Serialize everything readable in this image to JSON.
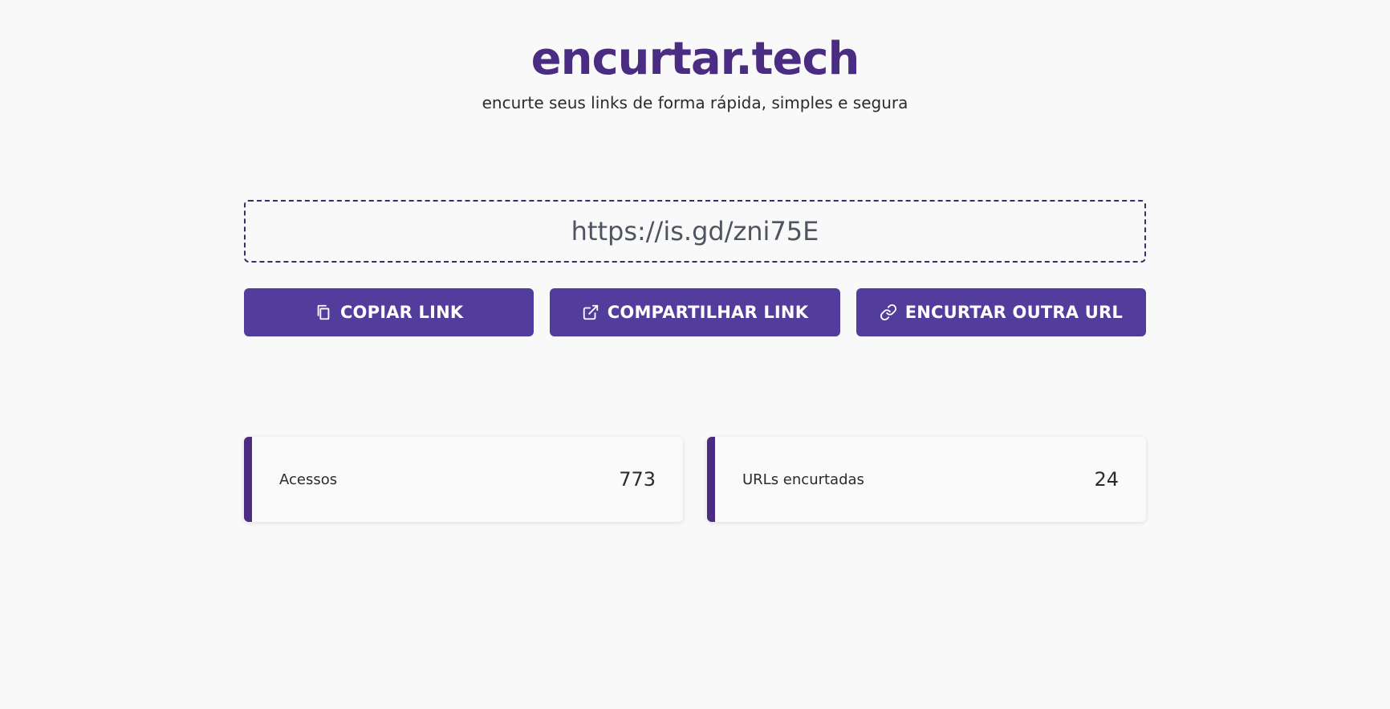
{
  "header": {
    "logo": "encurtar.tech",
    "tagline": "encurte seus links de forma rápida, simples e segura"
  },
  "result": {
    "short_url": "https://is.gd/zni75E"
  },
  "actions": {
    "copy_label": "COPIAR LINK",
    "share_label": "COMPARTILHAR LINK",
    "new_label": "ENCURTAR OUTRA URL"
  },
  "icons": {
    "copy": "copy-icon",
    "share": "external-link-icon",
    "new": "link-icon"
  },
  "stats": [
    {
      "label": "Acessos",
      "value": "773"
    },
    {
      "label": "URLs encurtadas",
      "value": "24"
    }
  ],
  "colors": {
    "brand": "#4a2d82",
    "button": "#533d9c",
    "background": "#f9f9f9"
  }
}
